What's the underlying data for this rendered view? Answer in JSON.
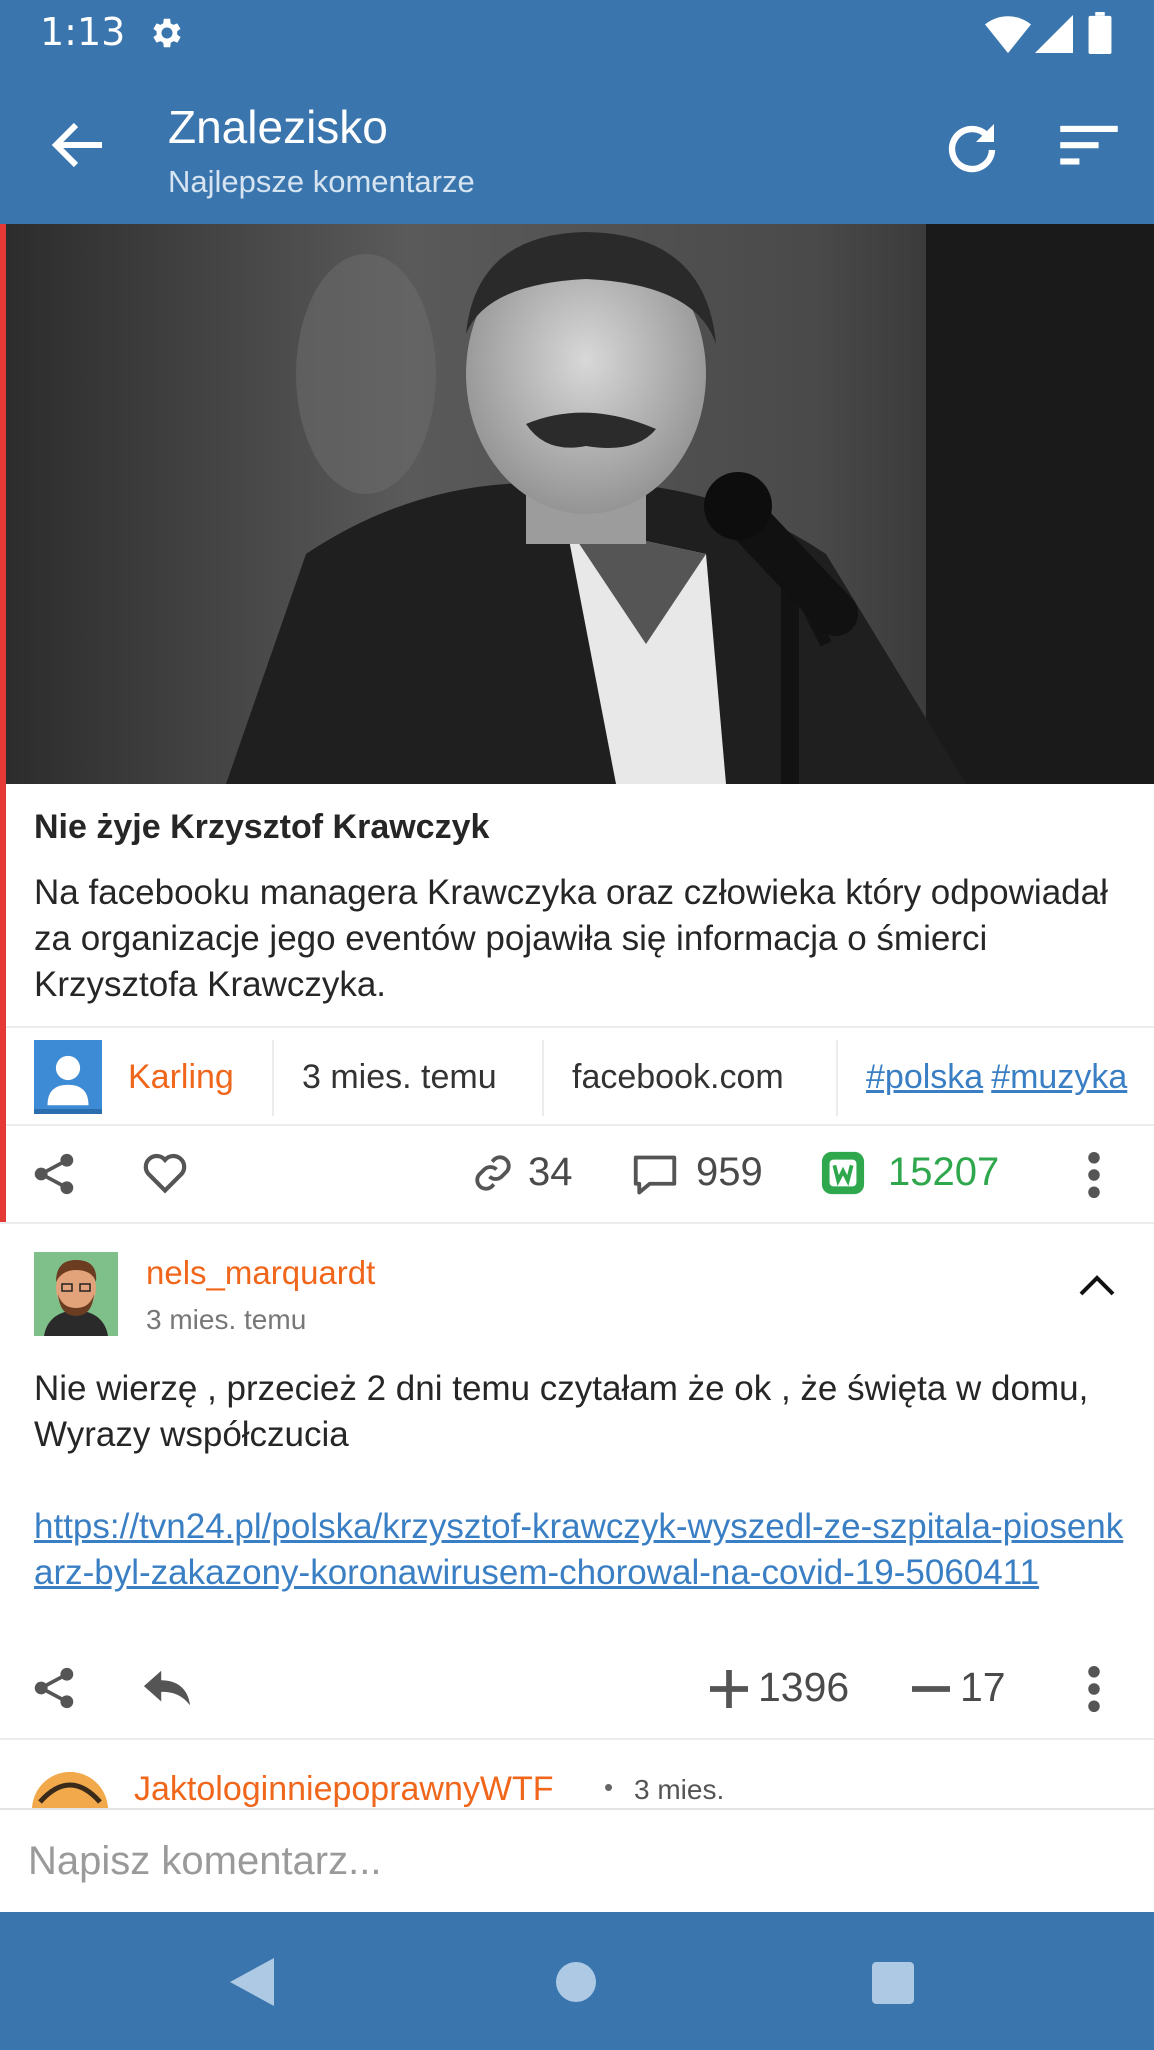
{
  "status_bar": {
    "time": "1:13",
    "icons": [
      "gear-icon",
      "wifi-icon",
      "signal-icon",
      "battery-icon"
    ]
  },
  "app_bar": {
    "title": "Znalezisko",
    "subtitle": "Najlepsze komentarze",
    "icons": [
      "back-arrow-icon",
      "refresh-icon",
      "sort-icon"
    ]
  },
  "article": {
    "title": "Nie żyje Krzysztof Krawczyk",
    "description": "Na facebooku managera Krawczyka oraz człowieka który odpowiadał za organizacje jego eventów pojawiła się informacja o śmierci Krzysztofa Krawczyka.",
    "author": "Karling",
    "time": "3 mies. temu",
    "source": "facebook.com",
    "tags": [
      "#polska",
      "#muzyka"
    ],
    "link_count": "34",
    "comment_count": "959",
    "vote_count": "15207"
  },
  "comment": {
    "user": "nels_marquardt",
    "time": "3 mies. temu",
    "body": "Nie wierzę , przecież 2 dni temu czytałam że ok , że święta w domu, Wyrazy współczucia",
    "link": "https://tvn24.pl/polska/krzysztof-krawczyk-wyszedl-ze-szpitala-piosenkarz-byl-zakazony-koronawirusem-chorowal-na-covid-19-5060411",
    "plus_count": "1396",
    "minus_count": "17"
  },
  "next_comment": {
    "user": "JaktologinniepoprawnyWTF",
    "dot": "•",
    "time": "3 mies."
  },
  "compose": {
    "placeholder": "Napisz komentarz..."
  },
  "colors": {
    "primary": "#3a76ad",
    "author_orange": "#f0661b",
    "link_blue": "#3a7fc4",
    "vote_green": "#2fa74d",
    "accent_red": "#e53935"
  }
}
